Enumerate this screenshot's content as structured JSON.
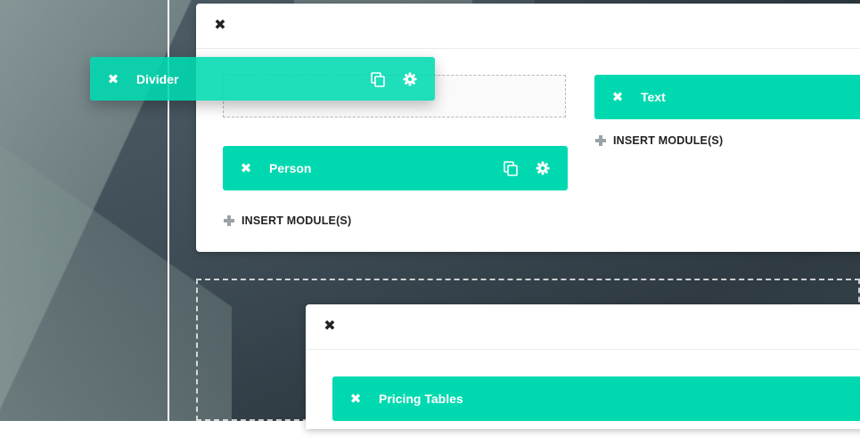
{
  "rows": [
    {
      "columns": [
        {
          "modules": [
            {
              "label": "Person",
              "tools": [
                "copy-icon",
                "gear-icon"
              ]
            }
          ],
          "insert_label": "INSERT MODULE(S)"
        },
        {
          "modules": [
            {
              "label": "Text"
            }
          ],
          "insert_label": "INSERT MODULE(S)"
        }
      ]
    },
    {
      "columns": [
        {
          "modules": [
            {
              "label": "Pricing Tables"
            }
          ]
        }
      ]
    }
  ],
  "dragging_module": {
    "label": "Divider",
    "tools": [
      "copy-icon",
      "gear-icon"
    ]
  },
  "colors": {
    "module_accent": "#00d9b0",
    "card": "#ffffff",
    "text_dark": "#222222"
  }
}
